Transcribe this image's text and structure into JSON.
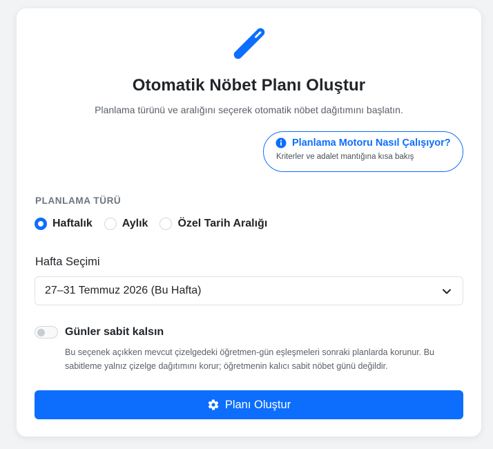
{
  "header": {
    "title": "Otomatik Nöbet Planı Oluştur",
    "subtitle": "Planlama türünü ve aralığını seçerek otomatik nöbet dağıtımını başlatın.",
    "hero_icon": "pencil-icon"
  },
  "info_pill": {
    "title": "Planlama Motoru Nasıl Çalışıyor?",
    "subtitle": "Kriterler ve adalet mantığına kısa bakış",
    "icon": "info-icon"
  },
  "plan_type": {
    "label": "PLANLAMA TÜRÜ",
    "selected": "Haftalık",
    "options": [
      {
        "label": "Haftalık",
        "checked": true
      },
      {
        "label": "Aylık",
        "checked": false
      },
      {
        "label": "Özel Tarih Aralığı",
        "checked": false
      }
    ]
  },
  "week_select": {
    "label": "Hafta Seçimi",
    "value": "27–31 Temmuz 2026 (Bu Hafta)"
  },
  "fixed_days": {
    "label": "Günler sabit kalsın",
    "enabled": false,
    "help": "Bu seçenek açıkken mevcut çizelgedeki öğretmen-gün eşleşmeleri sonraki planlarda korunur. Bu sabitleme yalnız çizelge dağıtımını korur; öğretmenin kalıcı sabit nöbet günü değildir."
  },
  "submit": {
    "label": "Planı Oluştur",
    "icon": "gear-icon"
  },
  "colors": {
    "primary": "#0d6efd",
    "text": "#212529",
    "muted": "#6c757d"
  }
}
